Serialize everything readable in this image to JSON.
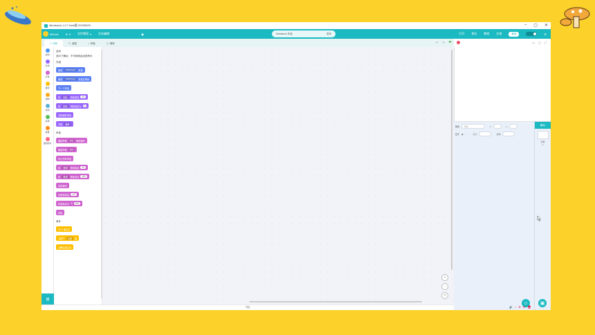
{
  "window": {
    "title": "Mindstock 1.0.7 beta版 20200525"
  },
  "window_controls": {
    "minimize": "–",
    "maximize": "▢",
    "close": "✕"
  },
  "menubar": {
    "brand": "Mblock",
    "items": [
      {
        "label": "文件教程"
      },
      {
        "label": "文本编辑"
      }
    ],
    "project_name": "Mindstock 作品",
    "publish": "发布",
    "right_labels": [
      "打开",
      "保存",
      "教程",
      "反馈"
    ],
    "login": "登录"
  },
  "tabs": [
    {
      "label": "代码"
    },
    {
      "label": "造型"
    },
    {
      "label": "声音"
    },
    {
      "label": "硬件"
    }
  ],
  "categories": [
    {
      "label": "运动",
      "color": "#4c97ff"
    },
    {
      "label": "外观",
      "color": "#9966ff"
    },
    {
      "label": "声音",
      "color": "#cf63cf"
    },
    {
      "label": "事件",
      "color": "#ffbf00"
    },
    {
      "label": "控制",
      "color": "#ffab19"
    },
    {
      "label": "侦测",
      "color": "#5cb1d6"
    },
    {
      "label": "运算",
      "color": "#59c059"
    },
    {
      "label": "变量",
      "color": "#ff8c1a"
    },
    {
      "label": "自制积木",
      "color": "#ff6680"
    }
  ],
  "palette": {
    "motion_title": "运动",
    "motion_note": "选中了舞台：不可使用运动类积木",
    "looks_title": "外观",
    "sound_title": "声音",
    "events_title": "事件",
    "blocks_looks": [
      {
        "text": "换成",
        "sel": "backdrop1",
        "tail": "背景",
        "color": "blue"
      },
      {
        "text": "换成",
        "sel": "backdrop1",
        "tail": "背景并等待",
        "color": "blue"
      },
      {
        "text": "下一个背景",
        "color": "blue"
      },
      {
        "text": "将",
        "sel": "颜色",
        "tail": "特效增加",
        "num": "25",
        "color": "purple"
      },
      {
        "text": "将",
        "sel": "颜色",
        "tail": "特效设定为",
        "num": "0",
        "color": "purple"
      },
      {
        "text": "清除图形特效",
        "color": "purple"
      },
      {
        "text": "背景",
        "sel": "编号",
        "color": "purple"
      }
    ],
    "blocks_sound": [
      {
        "text": "播放声音",
        "sel": "pop",
        "tail": "等待播完",
        "color": "pink"
      },
      {
        "text": "播放声音",
        "sel": "pop",
        "color": "pink"
      },
      {
        "text": "停止所有声音",
        "color": "pink"
      },
      {
        "text": "将",
        "sel": "音调",
        "tail": "音效增加",
        "num": "10",
        "color": "pink"
      },
      {
        "text": "将",
        "sel": "音调",
        "tail": "音效设为",
        "num": "100",
        "color": "pink"
      },
      {
        "text": "清除音效",
        "color": "pink"
      },
      {
        "text": "将音量增加",
        "num": "-10",
        "color": "pink"
      },
      {
        "text": "将音量设为",
        "num": "100",
        "tail": "%",
        "color": "pink"
      },
      {
        "text": "音量",
        "color": "pink"
      }
    ],
    "blocks_events": [
      {
        "text": "当 ⚑ 被点击",
        "color": "yellow"
      },
      {
        "text": "当按下",
        "sel": "空格",
        "tail": "键",
        "color": "yellow"
      },
      {
        "text": "当舞台被点击",
        "color": "yellow"
      }
    ]
  },
  "canvas": {
    "zoom_in": "+",
    "zoom_out": "−",
    "reset": "="
  },
  "bottom": {
    "label": "书包"
  },
  "props": {
    "sprite_label": "角色",
    "sprite_placeholder": "角色",
    "x_label": "x",
    "y_label": "y",
    "show_label": "显示",
    "size_label": "大小",
    "direction_label": "方向"
  },
  "backdrop_panel": {
    "title": "舞台",
    "label": "背景",
    "count": "1"
  },
  "taskbar": {
    "icons": "🔊 ♪ ⚙ ✉ 🖥"
  }
}
